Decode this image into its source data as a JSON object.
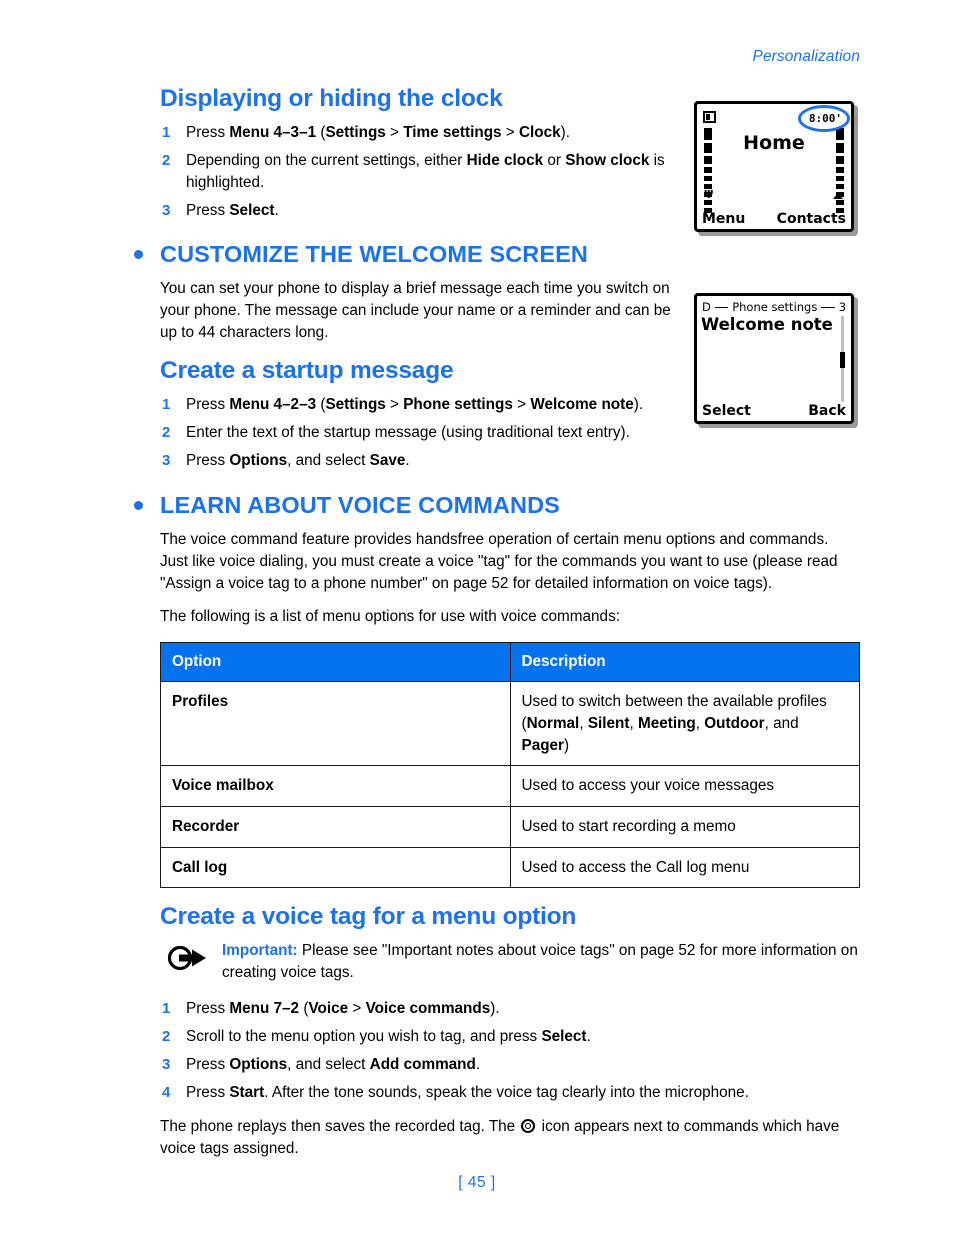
{
  "header": {
    "running_head": "Personalization"
  },
  "colors": {
    "accent_blue": "#1a72ef",
    "table_header_blue": "#0573f0",
    "text_black": "#000000"
  },
  "sections": {
    "clock": {
      "heading": "Displaying or hiding the clock",
      "steps": [
        {
          "num": "1",
          "parts": [
            {
              "t": "Press ",
              "b": false
            },
            {
              "t": "Menu 4-3-1",
              "b": true
            },
            {
              "t": " (",
              "b": false
            },
            {
              "t": "Settings",
              "b": true
            },
            {
              "t": " > ",
              "b": false
            },
            {
              "t": "Time settings",
              "b": true
            },
            {
              "t": " > ",
              "b": false
            },
            {
              "t": "Clock",
              "b": true
            },
            {
              "t": ").",
              "b": false
            }
          ]
        },
        {
          "num": "2",
          "parts": [
            {
              "t": "Depending on the current settings, either ",
              "b": false
            },
            {
              "t": "Hide clock",
              "b": true
            },
            {
              "t": " or ",
              "b": false
            },
            {
              "t": "Show clock",
              "b": true
            },
            {
              "t": " is highlighted.",
              "b": false
            }
          ]
        },
        {
          "num": "3",
          "parts": [
            {
              "t": "Press ",
              "b": false
            },
            {
              "t": "Select",
              "b": true
            },
            {
              "t": ".",
              "b": false
            }
          ]
        }
      ]
    },
    "welcome": {
      "heading": "CUSTOMIZE THE WELCOME SCREEN",
      "intro": "You can set your phone to display a brief message each time you switch on your phone. The message can include your name or a reminder and can be up to 44 characters long.",
      "sub_heading": "Create a startup message",
      "steps": [
        {
          "num": "1",
          "parts": [
            {
              "t": "Press ",
              "b": false
            },
            {
              "t": "Menu 4-2-3",
              "b": true
            },
            {
              "t": " (",
              "b": false
            },
            {
              "t": "Settings",
              "b": true
            },
            {
              "t": " > ",
              "b": false
            },
            {
              "t": "Phone settings",
              "b": true
            },
            {
              "t": " > ",
              "b": false
            },
            {
              "t": "Welcome note",
              "b": true
            },
            {
              "t": ").",
              "b": false
            }
          ]
        },
        {
          "num": "2",
          "parts": [
            {
              "t": "Enter the text of the startup message (using traditional text entry).",
              "b": false
            }
          ]
        },
        {
          "num": "3",
          "parts": [
            {
              "t": "Press ",
              "b": false
            },
            {
              "t": "Options",
              "b": true
            },
            {
              "t": ", and select ",
              "b": false
            },
            {
              "t": "Save",
              "b": true
            },
            {
              "t": ".",
              "b": false
            }
          ]
        }
      ]
    },
    "voice": {
      "heading": "LEARN ABOUT VOICE COMMANDS",
      "intro": "The voice command feature provides handsfree operation of certain menu options and commands. Just like voice dialing, you must create a voice \"tag\" for the commands you want to use (please read \"Assign a voice tag to a phone number\" on page 52 for detailed information on voice tags).",
      "list_lead": "The following is a list of menu options for use with voice commands:",
      "table": {
        "columns": [
          "Option",
          "Description"
        ],
        "rows": [
          {
            "option": "Profiles",
            "description_parts": [
              {
                "t": "Used to switch between the available profiles (",
                "b": false
              },
              {
                "t": "Normal",
                "b": true
              },
              {
                "t": ", ",
                "b": false
              },
              {
                "t": "Silent",
                "b": true
              },
              {
                "t": ", ",
                "b": false
              },
              {
                "t": "Meeting",
                "b": true
              },
              {
                "t": ", ",
                "b": false
              },
              {
                "t": "Outdoor",
                "b": true
              },
              {
                "t": ", and ",
                "b": false
              },
              {
                "t": "Pager",
                "b": true
              },
              {
                "t": ")",
                "b": false
              }
            ]
          },
          {
            "option": "Voice mailbox",
            "description_parts": [
              {
                "t": "Used to access your voice messages",
                "b": false
              }
            ]
          },
          {
            "option": "Recorder",
            "description_parts": [
              {
                "t": "Used to start recording a memo",
                "b": false
              }
            ]
          },
          {
            "option": "Call log",
            "description_parts": [
              {
                "t": "Used to access the Call log menu",
                "b": false
              }
            ]
          }
        ]
      },
      "sub_heading": "Create a voice tag for a menu option",
      "note": {
        "label": "Important:",
        "text": " Please see \"Important notes about voice tags\" on page 52 for more information on creating voice tags."
      },
      "steps": [
        {
          "num": "1",
          "parts": [
            {
              "t": "Press ",
              "b": false
            },
            {
              "t": "Menu 7-2",
              "b": true
            },
            {
              "t": " (",
              "b": false
            },
            {
              "t": "Voice",
              "b": true
            },
            {
              "t": " > ",
              "b": false
            },
            {
              "t": "Voice commands",
              "b": true
            },
            {
              "t": ").",
              "b": false
            }
          ]
        },
        {
          "num": "2",
          "parts": [
            {
              "t": "Scroll to the menu option you wish to tag, and press ",
              "b": false
            },
            {
              "t": "Select",
              "b": true
            },
            {
              "t": ".",
              "b": false
            }
          ]
        },
        {
          "num": "3",
          "parts": [
            {
              "t": "Press ",
              "b": false
            },
            {
              "t": "Options",
              "b": true
            },
            {
              "t": ", and select ",
              "b": false
            },
            {
              "t": "Add command",
              "b": true
            },
            {
              "t": ".",
              "b": false
            }
          ]
        },
        {
          "num": "4",
          "parts": [
            {
              "t": "Press ",
              "b": false
            },
            {
              "t": "Start",
              "b": true
            },
            {
              "t": ". After the tone sounds, speak the voice tag clearly into the microphone.",
              "b": false
            }
          ]
        }
      ],
      "closing_before": "The phone replays then saves the recorded tag. The ",
      "closing_after": " icon appears next to commands which have voice tags assigned."
    }
  },
  "figures": {
    "idle_screen": {
      "time": "8:00'",
      "main_text": "Home",
      "softkey_left": "Menu",
      "softkey_right": "Contacts"
    },
    "menu_screen": {
      "title_left": "D",
      "title": "Phone settings",
      "title_right": "3",
      "item": "Welcome note",
      "softkey_left": "Select",
      "softkey_right": "Back"
    }
  },
  "footer": {
    "page_number": "[ 45 ]"
  }
}
